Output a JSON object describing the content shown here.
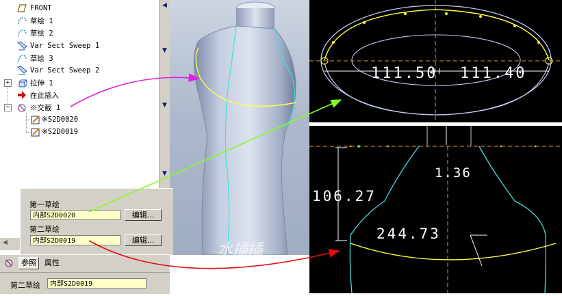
{
  "model_tree": {
    "items": [
      {
        "label": "FRONT",
        "icon": "datum-plane-icon"
      },
      {
        "label": "草绘 1",
        "icon": "sketch-icon"
      },
      {
        "label": "草绘 2",
        "icon": "sketch-icon"
      },
      {
        "label": "Var Sect Sweep 1",
        "icon": "sweep-icon"
      },
      {
        "label": "草绘 3",
        "icon": "sketch-icon"
      },
      {
        "label": "Var Sect Sweep 2",
        "icon": "sweep-icon"
      },
      {
        "label": "拉伸 1",
        "icon": "extrude-icon"
      },
      {
        "label": "在此插入",
        "icon": "insert-here-arrow-icon"
      },
      {
        "label": "※交截 1",
        "icon": "intersect-icon"
      },
      {
        "label": "※S2D0020",
        "icon": "section-sketch-icon"
      },
      {
        "label": "※S2D0019",
        "icon": "section-sketch-icon"
      }
    ],
    "expanders": [
      "+",
      "−"
    ]
  },
  "properties_panel": {
    "first_sketch_label": "第一草绘",
    "first_sketch_value": "内部S2D0020",
    "edit_button_1": "编辑...",
    "second_sketch_label": "第二草绘",
    "second_sketch_value": "内部S2D0019",
    "edit_button_2": "编辑..."
  },
  "tabs": {
    "references": "参照",
    "properties": "属性"
  },
  "status": {
    "label": "第二草绘",
    "value": "内部S2D0019"
  },
  "sketch_top": {
    "dim_left": "111.50",
    "dim_right": "111.40"
  },
  "sketch_bottom": {
    "dim_height": "106.27",
    "dim_small": "1.36",
    "dim_width": "244.73"
  },
  "watermark": "水插插",
  "colors": {
    "arrow_magenta": "#e020e0",
    "arrow_green": "#80ff20",
    "arrow_red": "#e01010",
    "curve_yellow": "#ffff40",
    "curve_cyan": "#40e0e0",
    "field_bg": "#ffffc8",
    "panel_bg": "#d4d0c8"
  }
}
